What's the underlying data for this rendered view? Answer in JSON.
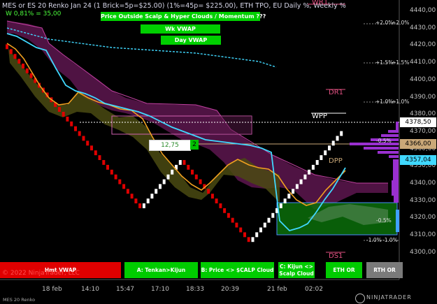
{
  "header": {
    "title": "MES or ES 20 Renko Jan 24 (1 Brick=5p=$25.00) (1%=45p= $225.00), ETH TPO, EU Daily %, Weekly %",
    "wline": "W 0,81% = 35,00",
    "wr1": "WR1"
  },
  "banners": {
    "b1": "Price Outside Scalp & Hyper Clouds / Momentum ???",
    "b2": "Wk VWAP",
    "b3": "Day VWAP"
  },
  "bottom_buttons": [
    {
      "label": "Hmt VWAP",
      "color": "#e00000"
    },
    {
      "label": "A: Tenkan>Kijun",
      "color": "#00cc00"
    },
    {
      "label": "B: Price <> $CALP Cloud",
      "color": "#00cc00"
    },
    {
      "label": "C: Kijun <>\nScalp Cloud",
      "color": "#00cc00"
    },
    {
      "label": "ETH OR",
      "color": "#00cc00"
    },
    {
      "label": "RTH OR",
      "color": "#7a7a7a"
    }
  ],
  "copyright": "© 2022 NinjaTrader, LLC",
  "footer_label": "MES 20 Renko",
  "brand": "NINJATRADER",
  "price_axis": {
    "ticks": [
      "4440,00",
      "4430,00",
      "4420,00",
      "4410,00",
      "4400,00",
      "4390,00",
      "4380,00",
      "4370,00",
      "4360,00",
      "4350,00",
      "4340,00",
      "4330,00",
      "4320,00",
      "4310,00",
      "4300,00"
    ],
    "markers": [
      {
        "label": "4378,50",
        "bg": "#ffffff",
        "fg": "#000000"
      },
      {
        "label": "4366,00",
        "bg": "#caa878",
        "fg": "#000000"
      },
      {
        "label": "4357,04",
        "bg": "#40d8ff",
        "fg": "#000000"
      }
    ]
  },
  "time_axis": [
    "18 feb",
    "14:10",
    "15:47",
    "17:10",
    "18:33",
    "20:39",
    "21 feb",
    "02:02"
  ],
  "levels": {
    "dr1": "DR1",
    "wpp": "WPP",
    "dpp": "DPP",
    "ds1": "DS1"
  },
  "percents": [
    "+2.0%",
    "+2.0%",
    "+1.5%",
    "+1.5%",
    "+1.0%",
    "+1.0%",
    "-0.5%",
    "-0.5%",
    "-1.0%",
    "-1.0%"
  ],
  "flags": {
    "value_box": "12,75",
    "count_box": "2"
  },
  "colors": {
    "up_brick": "#ffffff",
    "down_brick": "#e00000",
    "cyan_line": "#40d8ff",
    "orange_line": "#f0a020",
    "magenta_cloud": "#8a2070",
    "green_box": "#0a7a0a",
    "profile": "#9a30d0"
  },
  "chart_data": {
    "type": "line",
    "title": "",
    "xlabel": "",
    "ylabel": "",
    "ylim": [
      4300,
      4445
    ],
    "x": [
      "18 feb",
      "14:10",
      "15:47",
      "17:10",
      "18:33",
      "20:39",
      "21 feb",
      "02:02"
    ],
    "series": [
      {
        "values": [
          4422,
          4404,
          4386,
          4368,
          4336,
          4362,
          4352,
          4318,
          4346,
          4378
        ]
      },
      {
        "values": [
          4420,
          4414,
          4392,
          4376,
          4368,
          4364,
          4362,
          4358,
          4326,
          4357
        ]
      },
      {
        "values": [
          4414,
          4402,
          4386,
          4366,
          4348,
          4344,
          4350,
          4336,
          4330,
          4350
        ]
      },
      {
        "values": [
          4424,
          4420,
          4414,
          4412,
          4411,
          4410,
          4410,
          4409,
          4408,
          4408
        ]
      }
    ]
  }
}
